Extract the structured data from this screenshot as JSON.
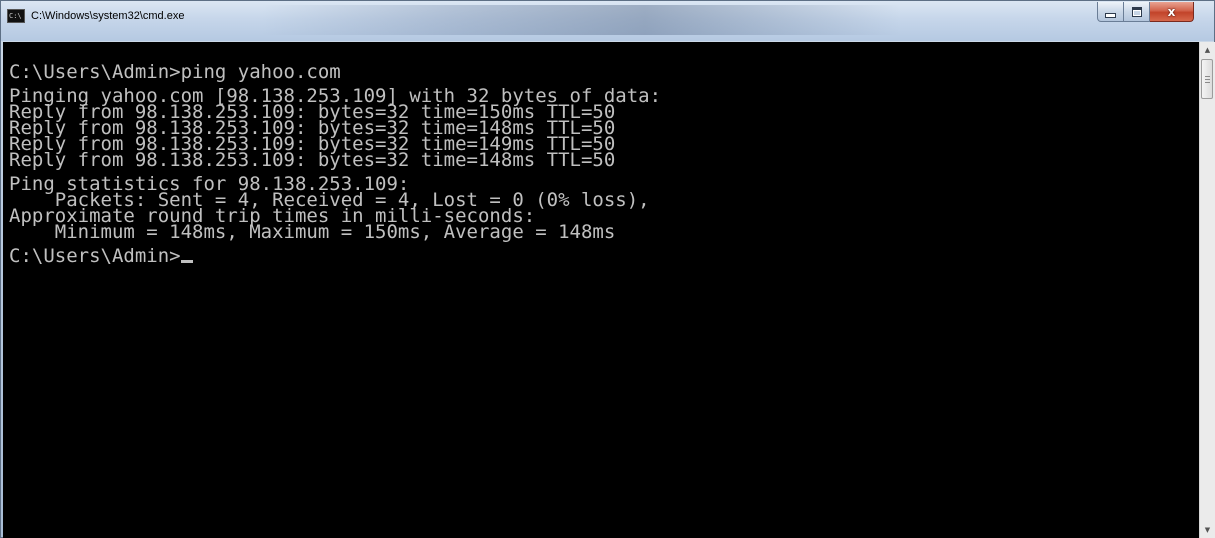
{
  "window": {
    "title": "C:\\Windows\\system32\\cmd.exe",
    "icon_name": "cmd-icon",
    "icon_text": "C:\\",
    "controls": {
      "minimize_icon": "minimize-icon",
      "maximize_icon": "maximize-icon",
      "close_icon": "close-icon",
      "close_glyph": "x"
    }
  },
  "console": {
    "foreground": "#c0c0c0",
    "background": "#000000",
    "prompt_command": "C:\\Users\\Admin>ping yahoo.com",
    "pinging": "Pinging yahoo.com [98.138.253.109] with 32 bytes of data:",
    "replies": [
      "Reply from 98.138.253.109: bytes=32 time=150ms TTL=50",
      "Reply from 98.138.253.109: bytes=32 time=148ms TTL=50",
      "Reply from 98.138.253.109: bytes=32 time=149ms TTL=50",
      "Reply from 98.138.253.109: bytes=32 time=148ms TTL=50"
    ],
    "statistics_header": "Ping statistics for 98.138.253.109:",
    "packets": "    Packets: Sent = 4, Received = 4, Lost = 0 (0% loss),",
    "rtt_header": "Approximate round trip times in milli-seconds:",
    "rtt_values": "    Minimum = 148ms, Maximum = 150ms, Average = 148ms",
    "final_prompt": "C:\\Users\\Admin>"
  },
  "scrollbar": {
    "up_icon": "scroll-up-arrow-icon",
    "down_icon": "scroll-down-arrow-icon"
  }
}
